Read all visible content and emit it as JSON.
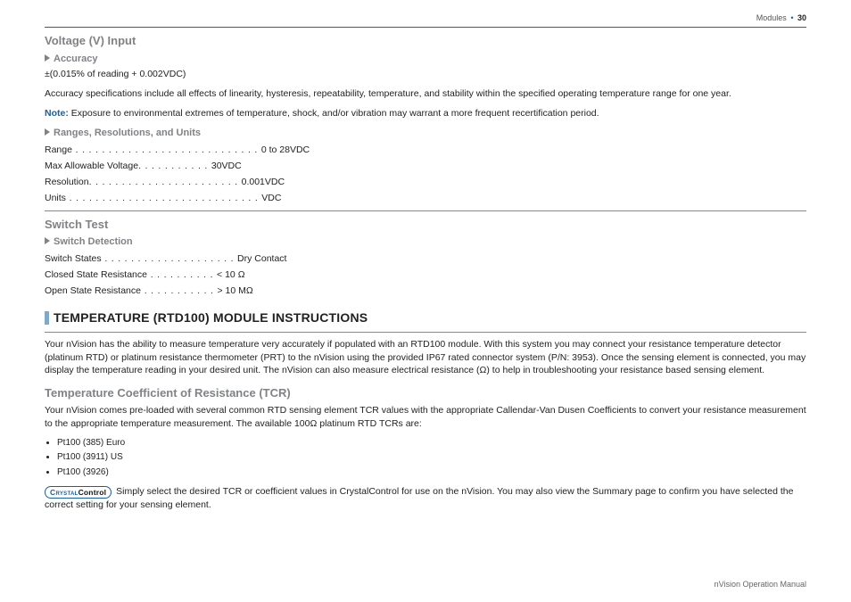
{
  "header": {
    "section": "Modules",
    "page": "30"
  },
  "voltage": {
    "title": "Voltage (V) Input",
    "accuracy": {
      "heading": "Accuracy",
      "line": "±(0.015% of reading + 0.002VDC)",
      "para": "Accuracy specifications include all effects of linearity, hysteresis, repeatability, temperature, and stability within the specified operating temperature range for one year.",
      "note_label": "Note:",
      "note_text": " Exposure to environmental extremes of temperature, shock, and/or vibration may warrant a more frequent recertification period."
    },
    "ranges": {
      "heading": "Ranges, Resolutions, and Units",
      "rows": [
        {
          "label": "Range",
          "dots": " . . . . . . . . . . . . . . . . . . . . . . . . . . . . ",
          "value": "0 to 28VDC"
        },
        {
          "label": "Max Allowable Voltage",
          "dots": ". . . . . . . . . . . ",
          "value": "30VDC"
        },
        {
          "label": "Resolution",
          "dots": ". . . . . . . . . . . . . . . . . . . . . . . ",
          "value": "0.001VDC"
        },
        {
          "label": "Units",
          "dots": " . . . . . . . . . . . . . . . . . . . . . . . . . . . . . ",
          "value": "VDC"
        }
      ]
    }
  },
  "switch": {
    "title": "Switch Test",
    "detection": {
      "heading": "Switch Detection",
      "rows": [
        {
          "label": "Switch States",
          "dots": " . . . . . . . . . . . . . . . . . . . . ",
          "value": "Dry Contact"
        },
        {
          "label": "Closed State Resistance",
          "dots": " . . . . . . . . . . ",
          "value": "< 10 Ω"
        },
        {
          "label": "Open State Resistance",
          "dots": " . . . . . . . . . . . ",
          "value": "> 10 MΩ"
        }
      ]
    }
  },
  "rtd": {
    "heading": "TEMPERATURE (RTD100) MODULE INSTRUCTIONS",
    "intro": "Your nVision has the ability to measure temperature very accurately if populated with an RTD100 module. With this system you may connect your resistance temperature detector (platinum RTD) or platinum resistance thermometer (PRT) to the nVision using the provided IP67 rated connector system (P/N: 3953). Once the sensing element is connected, you may display the temperature reading in your desired unit. The nVision can also measure electrical resistance (Ω) to help in troubleshooting your resistance based sensing element."
  },
  "tcr": {
    "title": "Temperature Coefficient of Resistance (TCR)",
    "para": "Your nVision comes pre-loaded with several common RTD sensing element TCR values with the appropriate Callendar-Van Dusen Coefficients to convert your resistance measurement to the appropriate temperature measurement. The available 100Ω platinum RTD TCRs are:",
    "items": [
      "Pt100 (385) Euro",
      "Pt100 (3911) US",
      "Pt100 (3926)"
    ],
    "cc_brand1": "Crystal",
    "cc_brand2": "Control",
    "cc_text": " Simply select the desired TCR or coefficient values in CrystalControl for use on the nVision. You may also view the Summary page to confirm you have selected the correct setting for your sensing element."
  },
  "footer": "nVision Operation Manual"
}
